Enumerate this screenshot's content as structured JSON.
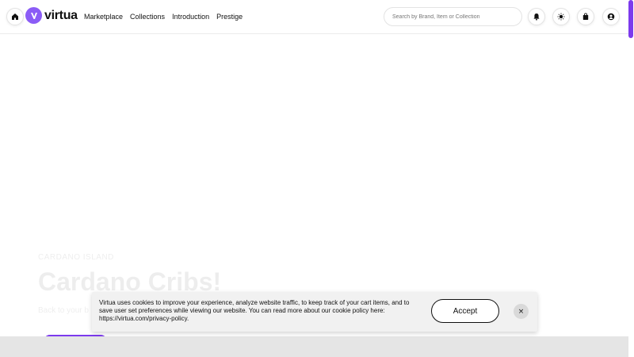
{
  "header": {
    "logo_text": "virtua",
    "nav": [
      {
        "label": "Marketplace"
      },
      {
        "label": "Collections"
      },
      {
        "label": "Introduction"
      },
      {
        "label": "Prestige"
      }
    ],
    "search_placeholder": "Search by Brand, Item or Collection",
    "icons": [
      "home-icon",
      "bell-icon",
      "sun-icon",
      "bag-icon",
      "user-icon"
    ]
  },
  "hero": {
    "kicker": "CARDANO ISLAND",
    "title": "Cardano Cribs!",
    "subtitle": "Back to your b"
  },
  "cookie_banner": {
    "text": "Virtua uses cookies to improve your experience, analyze website traffic, to keep track of your cart items, and to save user set preferences while viewing our website. You can read more about our cookie policy here: https://virtua.com/privacy-policy.",
    "accept_label": "Accept",
    "close_label": "×"
  },
  "colors": {
    "accent": "#8b5cf6",
    "accent_dark": "#7c3aed",
    "banner_bg": "#f1f1f1"
  }
}
